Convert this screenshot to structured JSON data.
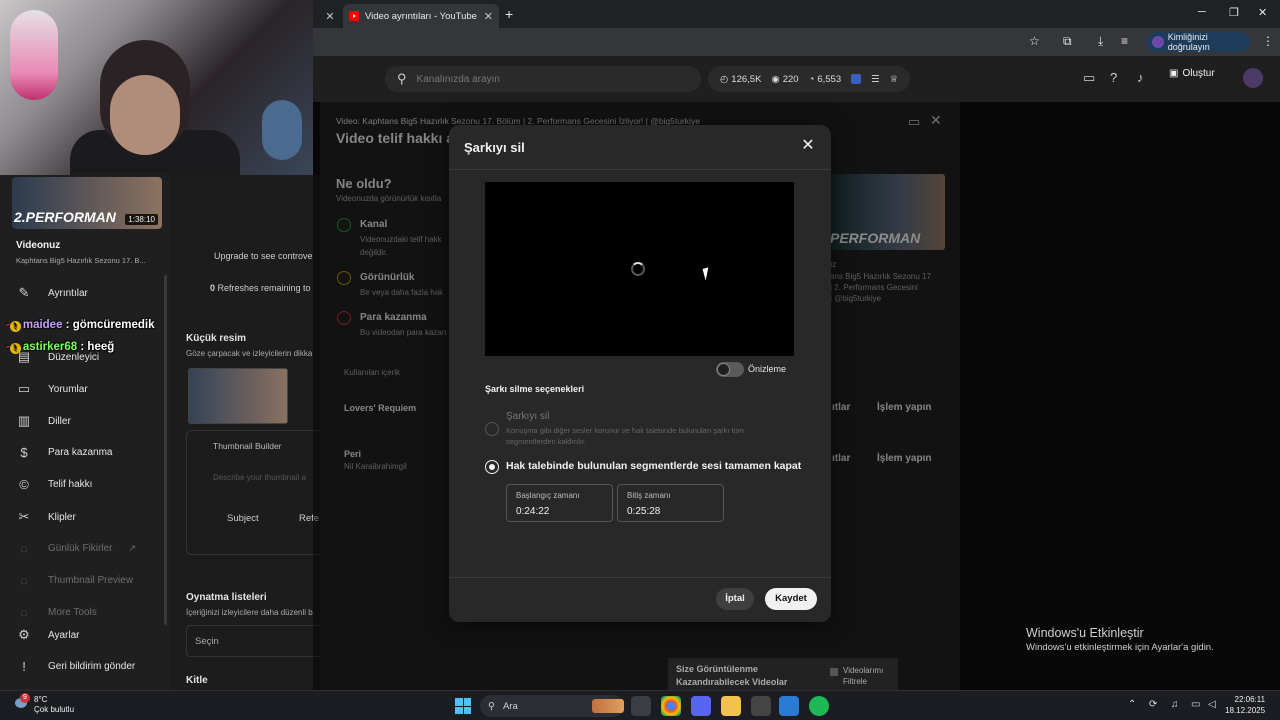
{
  "browser": {
    "tab_title": "Video ayrıntıları - YouTube Studio",
    "tab_close": "✕",
    "other_tab_close": "✕",
    "new_tab": "+",
    "verify_label": "Kimliğinizi doğrulayın"
  },
  "studio_header": {
    "search_placeholder": "Kanalınızda arayın",
    "stats": {
      "views": "126,5K",
      "subs": "220",
      "likes": "6,553"
    },
    "create_label": "Oluştur"
  },
  "sidebar": {
    "thumb_text": "2.PERFORMAN",
    "thumb_duration": "1:38:10",
    "video_title": "Videonuz",
    "video_subtitle": "Kaphtans Big5 Hazırlık Sezonu 17. B...",
    "items": [
      {
        "label": "Ayrıntılar"
      },
      {
        "label": "Düzenleyici"
      },
      {
        "label": "Yorumlar"
      },
      {
        "label": "Diller"
      },
      {
        "label": "Para kazanma"
      },
      {
        "label": "Telif hakkı"
      },
      {
        "label": "Klipler"
      },
      {
        "label": "Günlük Fikirler"
      },
      {
        "label": "Thumbnail Preview"
      },
      {
        "label": "More Tools"
      },
      {
        "label": "Ayarlar"
      },
      {
        "label": "Geri bildirim gönder"
      }
    ]
  },
  "middle": {
    "upgrade": "Upgrade to see controve",
    "refreshes_count": "0",
    "refreshes": " Refreshes remaining to",
    "thumb_heading": "Küçük resim",
    "thumb_desc": "Göze çarpacak ve izleyicilerin dikka",
    "thumb_builder": "Thumbnail Builder",
    "describe": "Describe your thumbnail a",
    "subject": "Subject",
    "refe": "Refe",
    "playlists_heading": "Oynatma listeleri",
    "playlists_desc": "İçeriğinizi izleyicilere daha düzenli b",
    "select": "Seçin",
    "audience": "Kitle"
  },
  "back_dialog": {
    "video_line": "Video: Kaphtans Big5 Hazırlık Sezonu 17. Bölüm | 2. Performans Gecesini İzliyor! | @big5turkiye",
    "title": "Video telif hakkı ay",
    "what_happened": "Ne oldu?",
    "what_desc": "Videonuzda görünürlük kısıtla",
    "channel": "Kanal",
    "channel_desc": "Videonuzdaki telif hakk",
    "channel_desc2": "değildir.",
    "visibility": "Görünürlük",
    "visibility_desc": "Bir veya daha fazla hak",
    "monetize": "Para kazanma",
    "monetize_desc": "Bu videodan para kazan",
    "used_content": "Kullanılan içerik",
    "song1": "Lovers' Requiem",
    "song2": "Peri",
    "song2_artist": "Nil Karaibrahimgil",
    "action1": "İşlem yapın",
    "action2": "İşlem yapın",
    "partial1": "ıtlar",
    "partial2": "ıtlar",
    "right_thumb": "PERFORMAN",
    "right_desc1": "ız",
    "right_desc2": "ans Big5 Hazırlık Sezonu 17",
    "right_desc3": "| 2. Performans Gecesini",
    "right_desc4": "| @big5turkiye"
  },
  "bottom": {
    "size_label": "Size Görüntülenme",
    "size_label2": "Kazandırabilecek Videolar",
    "videolar": "Videolarımı",
    "filtrele": "Filtrele"
  },
  "modal": {
    "title": "Şarkıyı sil",
    "preview_label": "Önizleme",
    "options_heading": "Şarkı silme seçenekleri",
    "option1_title": "Şarkıyı sil",
    "option1_desc": "Konuşma gibi diğer sesler korunur ve hak talebinde bulunulan şarkı tüm segmentlerden kaldırılır.",
    "option2_title": "Hak talebinde bulunulan segmentlerde sesi tamamen kapat",
    "start_label": "Başlangıç zamanı",
    "start_value": "0:24:22",
    "end_label": "Bitiş zamanı",
    "end_value": "0:25:28",
    "cancel_label": "İptal",
    "save_label": "Kaydet"
  },
  "chat": [
    {
      "user": "maidee",
      "message": " : gömcüremedik"
    },
    {
      "user": "astirker68",
      "message": " : heeğ"
    }
  ],
  "windows": {
    "activate_title": "Windows'u Etkinleştir",
    "activate_desc": "Windows'u etkinleştirmek için Ayarlar'a gidin."
  },
  "taskbar": {
    "temp": "8°C",
    "weather": "Çok bulutlu",
    "weather_badge": "9",
    "search": "Ara",
    "time": "22:06:11",
    "date": "18.12.2025"
  },
  "colors": {
    "accent": "#3ea6ff",
    "save_bg": "#f1f1f1",
    "modal_bg": "#282828"
  }
}
